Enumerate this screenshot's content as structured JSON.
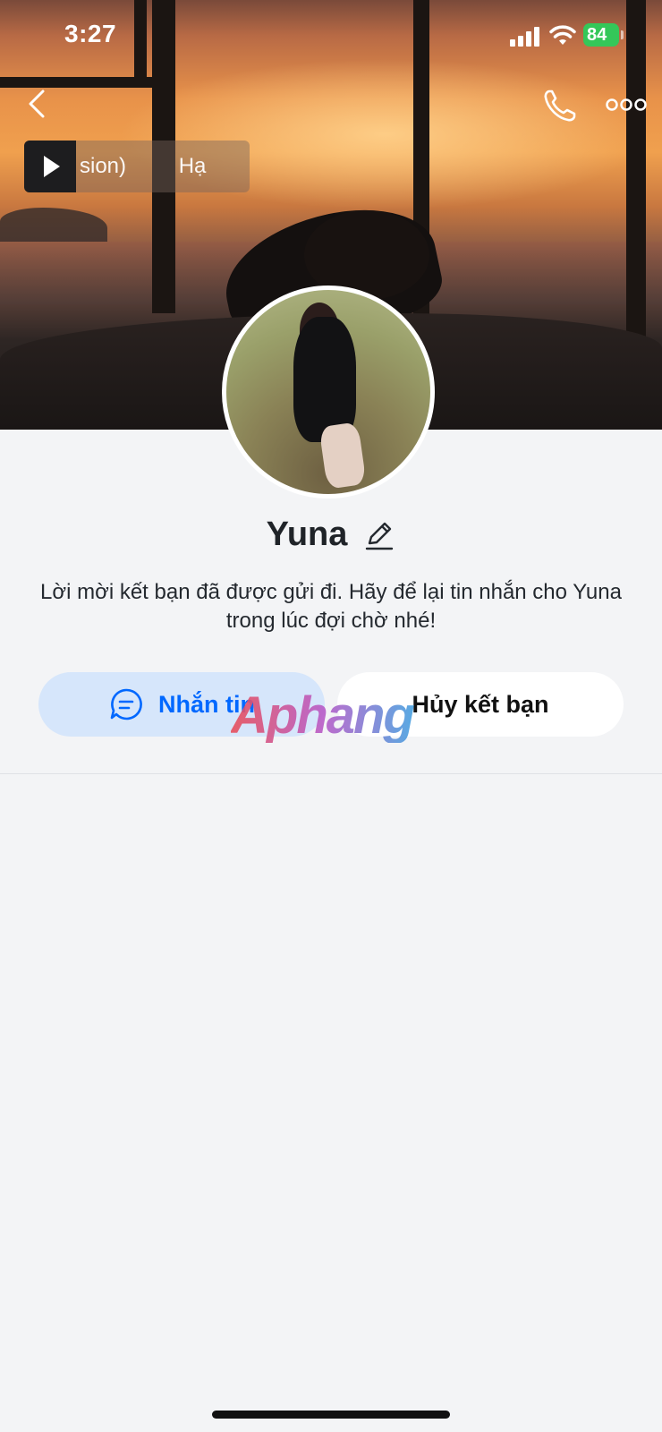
{
  "status_bar": {
    "time": "3:27",
    "battery": "84"
  },
  "music": {
    "text": "sion)   Hạ Ta"
  },
  "profile": {
    "name": "Yuna",
    "message": "Lời mời kết bạn đã được gửi đi. Hãy để lại tin nhắn cho Yuna trong lúc đợi chờ nhé!"
  },
  "actions": {
    "message_label": "Nhắn tin",
    "unfriend_label": "Hủy kết bạn"
  },
  "watermark": "Aphang",
  "colors": {
    "accent": "#0068ff",
    "message_button_bg": "#d6e6fb",
    "battery": "#34c759",
    "background": "#f3f4f6"
  }
}
